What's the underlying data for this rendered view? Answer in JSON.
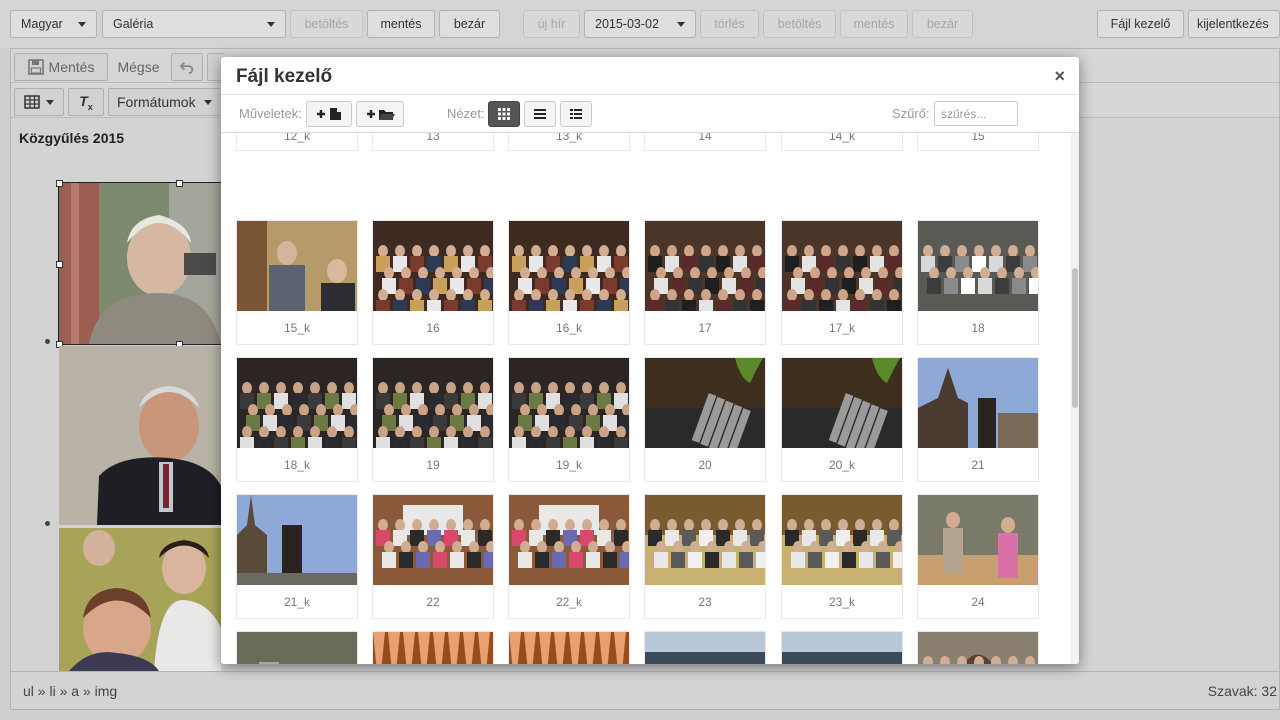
{
  "topbar": {
    "language": "Magyar",
    "section": "Galéria",
    "load_label": "betöltés",
    "save_label": "mentés",
    "close_label": "bezár",
    "new_news_label": "új hír",
    "date_value": "2015-03-02",
    "delete_label": "törlés",
    "load2_label": "betöltés",
    "save2_label": "mentés",
    "close2_label": "bezár",
    "file_manager_label": "Fájl kezelő",
    "logout_label": "kijelentkezés"
  },
  "editor": {
    "save_label": "Mentés",
    "cancel_label": "Mégse",
    "formats_label": "Formátumok",
    "page_title": "Közgyűlés 2015"
  },
  "statusbar": {
    "path": "ul » li » a » img",
    "word_count": "Szavak: 32"
  },
  "modal": {
    "title": "Fájl kezelő",
    "close_glyph": "×",
    "operations_label": "Műveletek:",
    "view_label": "Nézet:",
    "filter_label": "Szűrő:",
    "filter_placeholder": "szűrés...",
    "files": [
      "12_k",
      "13",
      "13_k",
      "14",
      "14_k",
      "15",
      "15_k",
      "16",
      "16_k",
      "17",
      "17_k",
      "18",
      "18_k",
      "19",
      "19_k",
      "20",
      "20_k",
      "21",
      "21_k",
      "22",
      "22_k",
      "23",
      "23_k",
      "24",
      "",
      "",
      "",
      "",
      "",
      ""
    ]
  },
  "colors": {
    "accent_dark": "#555555",
    "toolbar_bg": "#d4d4d4",
    "caption": "#777777"
  }
}
